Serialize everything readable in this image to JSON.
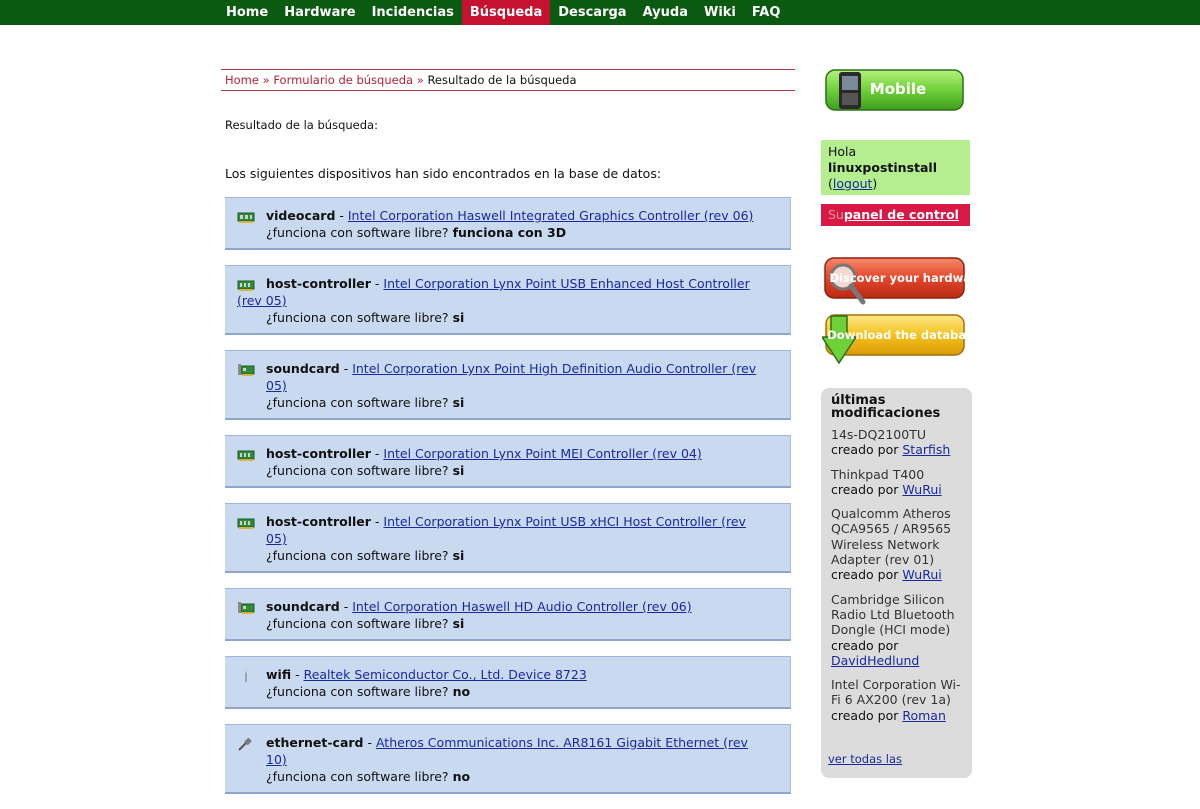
{
  "nav": {
    "items": [
      {
        "label": "Home"
      },
      {
        "label": "Hardware"
      },
      {
        "label": "Incidencias"
      },
      {
        "label": "Búsqueda"
      },
      {
        "label": "Descarga"
      },
      {
        "label": "Ayuda"
      },
      {
        "label": "Wiki"
      },
      {
        "label": "FAQ"
      }
    ],
    "active": "Búsqueda",
    "bar_color": "#0a5a12",
    "active_color": "#c41230"
  },
  "breadcrumb": {
    "home": "Home",
    "sep": "»",
    "form": "Formulario de búsqueda",
    "current": "Resultado de la búsqueda"
  },
  "result_title": "Resultado de la búsqueda:",
  "found_text": "Los siguientes dispositivos han sido encontrados en la base de datos:",
  "question": "¿funciona con software libre?",
  "devices": [
    {
      "category": "videocard",
      "name": "Intel Corporation Haswell Integrated Graphics Controller (rev 06)",
      "status": "funciona con 3D",
      "icon": "videocard-icon"
    },
    {
      "category": "host-controller",
      "name": "Intel Corporation Lynx Point USB Enhanced Host Controller (rev 05)",
      "status": "si",
      "icon": "host-controller-icon"
    },
    {
      "category": "soundcard",
      "name": "Intel Corporation Lynx Point High Definition Audio Controller (rev 05)",
      "status": "si",
      "icon": "soundcard-icon"
    },
    {
      "category": "host-controller",
      "name": "Intel Corporation Lynx Point MEI Controller (rev 04)",
      "status": "si",
      "icon": "host-controller-icon"
    },
    {
      "category": "host-controller",
      "name": "Intel Corporation Lynx Point USB xHCI Host Controller (rev 05)",
      "status": "si",
      "icon": "host-controller-icon"
    },
    {
      "category": "soundcard",
      "name": "Intel Corporation Haswell HD Audio Controller (rev 06)",
      "status": "si",
      "icon": "soundcard-icon"
    },
    {
      "category": "wifi",
      "name": "Realtek Semiconductor Co., Ltd. Device 8723",
      "status": "no",
      "icon": "wifi-icon"
    },
    {
      "category": "ethernet-card",
      "name": "Atheros Communications Inc. AR8161 Gigabit Ethernet (rev 10)",
      "status": "no",
      "icon": "ethernet-card-icon"
    }
  ],
  "sidebar": {
    "mobile_label": "Mobile",
    "hello": "Hola",
    "username": "linuxpostinstall",
    "logout_open": "(",
    "logout": "logout",
    "logout_close": ")",
    "panel_prefix": "Su",
    "panel_link": "panel de control",
    "discover_label": "Discover your hardware",
    "download_label": "Download the database",
    "updates_title": "últimas modificaciones",
    "created_by": "creado por",
    "updates": [
      {
        "model": "14s-DQ2100TU",
        "user": "Starfish"
      },
      {
        "model": "Thinkpad T400",
        "user": "WuRui"
      },
      {
        "model": "Qualcomm Atheros QCA9565 / AR9565 Wireless Network Adapter (rev 01)",
        "user": "WuRui"
      },
      {
        "model": "Cambridge Silicon Radio Ltd Bluetooth Dongle (HCI mode)",
        "user": "DavidHedlund"
      },
      {
        "model": "Intel Corporation Wi-Fi 6 AX200 (rev 1a)",
        "user": "Roman"
      }
    ],
    "see_all": "ver todas las"
  }
}
